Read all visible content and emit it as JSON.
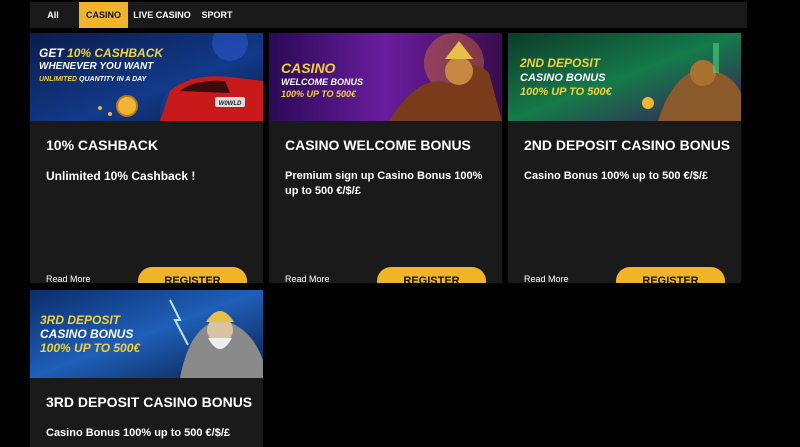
{
  "tabs": [
    {
      "label": "All",
      "active": false
    },
    {
      "label": "CASINO",
      "active": true
    },
    {
      "label": "LIVE CASINO",
      "active": false
    },
    {
      "label": "SPORT",
      "active": false
    }
  ],
  "cards": [
    {
      "banner": {
        "line1a": "GET ",
        "line1b": "10% CASHBACK",
        "line2": "WHENEVER YOU WANT",
        "line3a": "UNLIMITED",
        "line3b": " QUANTITY IN A DAY",
        "plate": "W0WLD"
      },
      "title": "10% CASHBACK",
      "description": "Unlimited 10% Cashback !",
      "read_more": "Read More",
      "register": "REGISTER"
    },
    {
      "banner": {
        "line1": "CASINO",
        "line2": "WELCOME BONUS",
        "line3": "100% UP TO 500€"
      },
      "title": "CASINO WELCOME BONUS",
      "description": "Premium sign up Casino Bonus 100% up to 500 €/$/£",
      "read_more": "Read More",
      "register": "REGISTER"
    },
    {
      "banner": {
        "line1": "2ND DEPOSIT",
        "line2": "CASINO BONUS",
        "line3": "100% UP TO 500€"
      },
      "title": "2ND DEPOSIT CASINO BONUS",
      "description": "Casino Bonus 100% up to 500 €/$/£",
      "read_more": "Read More",
      "register": "REGISTER"
    },
    {
      "banner": {
        "line1": "3RD DEPOSIT",
        "line2": "CASINO BONUS",
        "line3": "100% UP TO 500€"
      },
      "title": "3RD DEPOSIT CASINO BONUS",
      "description": "Casino Bonus 100% up to 500 €/$/£"
    }
  ],
  "colors": {
    "accent": "#f0b429",
    "card_bg": "#1a1a1a",
    "page_bg": "#000000"
  }
}
